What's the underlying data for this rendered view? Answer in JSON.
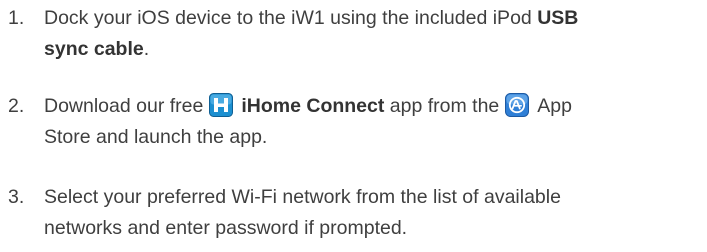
{
  "steps": [
    {
      "number": "1.",
      "line1_a": "Dock your iOS device to the iW1 using the included iPod ",
      "line1_bold": "USB",
      "line2_bold": "sync cable",
      "line2_tail": "."
    },
    {
      "number": "2.",
      "line1_a": "Download our free",
      "icon1": "ihome-app-icon",
      "line1_bold": "iHome Connect",
      "line1_b": " app from the",
      "icon2": "app-store-icon",
      "line1_c": "App",
      "line2": "Store and launch the app."
    },
    {
      "number": "3.",
      "line1": "Select your preferred Wi-Fi network from the list of available",
      "line2": "networks and enter password if prompted."
    }
  ],
  "colors": {
    "text": "#3f3f3f",
    "ihome_icon": "#1c8fd0",
    "app_store_icon": "#2f7fd6"
  }
}
